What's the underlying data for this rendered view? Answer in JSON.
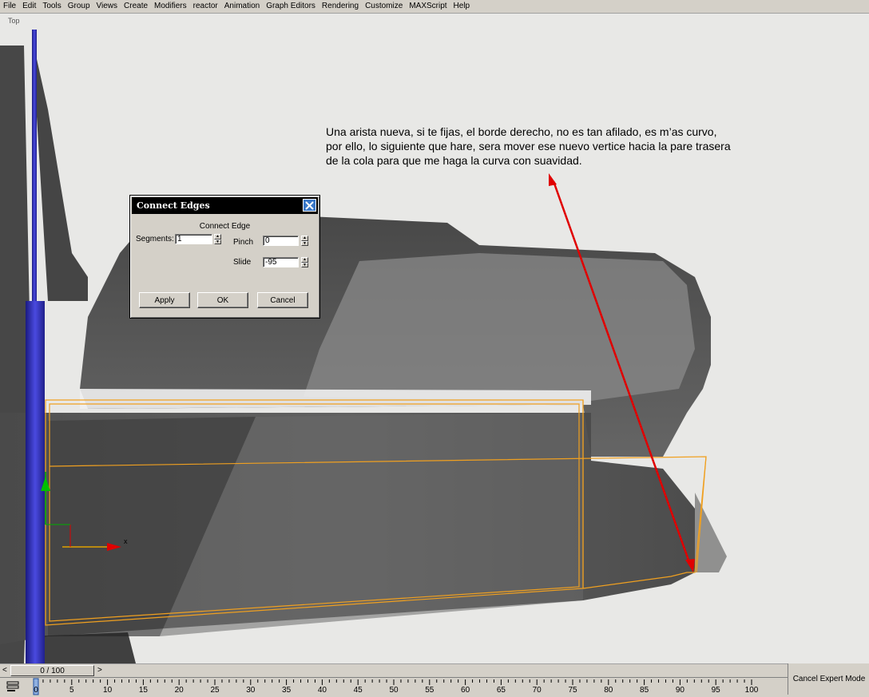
{
  "menu": [
    "File",
    "Edit",
    "Tools",
    "Group",
    "Views",
    "Create",
    "Modifiers",
    "reactor",
    "Animation",
    "Graph Editors",
    "Rendering",
    "Customize",
    "MAXScript",
    "Help"
  ],
  "viewport": {
    "label": "Top",
    "annotation_lines": [
      "Una arista nueva, si te fijas, el borde derecho, no es tan afilado, es m’as curvo,",
      "por ello, lo siguiente que hare, sera mover ese nuevo vertice hacia la pare trasera",
      "de la cola para que me haga la curva con suavidad."
    ],
    "axis_x_label": "x",
    "colors": {
      "selection": "#f0a020",
      "arrow": "#e00000",
      "frame": "#f0e040"
    }
  },
  "dialog": {
    "title": "Connect Edges",
    "group_title": "Connect Edge",
    "segments_label": "Segments:",
    "segments_value": "1",
    "pinch_label": "Pinch",
    "pinch_value": "0",
    "slide_label": "Slide",
    "slide_value": "-95",
    "apply_label": "Apply",
    "ok_label": "OK",
    "cancel_label": "Cancel"
  },
  "timeline": {
    "slider_text": "0 / 100",
    "tick_labels": [
      "0",
      "5",
      "10",
      "15",
      "20",
      "25",
      "30",
      "35",
      "40",
      "45",
      "50",
      "55",
      "60",
      "65",
      "70",
      "75",
      "80",
      "85",
      "90",
      "95",
      "100"
    ]
  },
  "status": {
    "expert_mode_label": "Cancel Expert Mode"
  }
}
